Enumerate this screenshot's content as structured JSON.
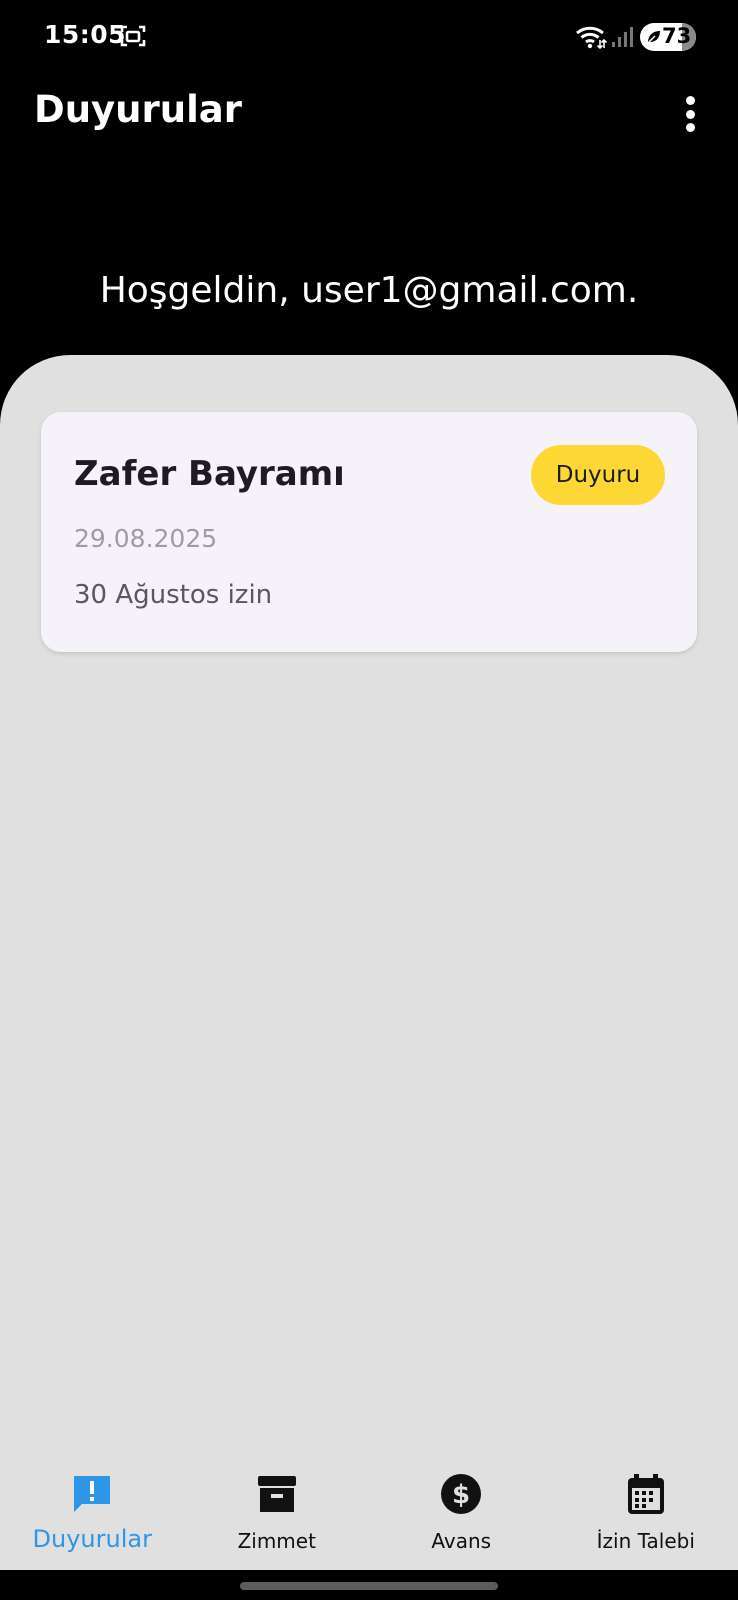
{
  "status_bar": {
    "time": "15:05",
    "battery": "73",
    "icons": [
      "screenshot-icon",
      "wifi-icon",
      "signal-icon",
      "battery-saver-icon"
    ]
  },
  "app_bar": {
    "title": "Duyurular",
    "menu_icon": "more-vert-icon"
  },
  "welcome": "Hoşgeldin, user1@gmail.com.",
  "announcements": [
    {
      "title": "Zafer Bayramı",
      "badge": "Duyuru",
      "date": "29.08.2025",
      "description": "30 Ağustos izin"
    }
  ],
  "bottom_nav": {
    "items": [
      {
        "label": "Duyurular",
        "icon": "announcement-icon",
        "active": true
      },
      {
        "label": "Zimmet",
        "icon": "archive-box-icon",
        "active": false
      },
      {
        "label": "Avans",
        "icon": "dollar-circle-icon",
        "active": false
      },
      {
        "label": "İzin Talebi",
        "icon": "calendar-icon",
        "active": false
      }
    ]
  },
  "colors": {
    "accent": "#2f96e6",
    "badge": "#fdd835",
    "card_bg": "#f6f2f9",
    "content_bg": "#e0e0e0",
    "header_bg": "#000000"
  }
}
